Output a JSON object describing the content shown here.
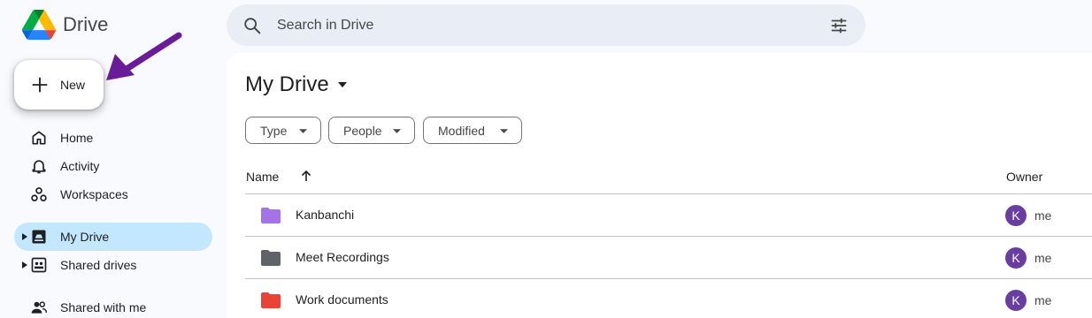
{
  "app": {
    "name": "Drive"
  },
  "search": {
    "placeholder": "Search in Drive"
  },
  "new_button": {
    "label": "New"
  },
  "annotation": {
    "arrow_color": "#6a1b9a"
  },
  "sidebar": {
    "items": [
      {
        "label": "Home",
        "icon": "home-icon"
      },
      {
        "label": "Activity",
        "icon": "bell-icon"
      },
      {
        "label": "Workspaces",
        "icon": "workspaces-icon"
      },
      {
        "label": "My Drive",
        "icon": "my-drive-icon",
        "active": true
      },
      {
        "label": "Shared drives",
        "icon": "shared-drives-icon"
      },
      {
        "label": "Shared with me",
        "icon": "people-icon"
      }
    ]
  },
  "main": {
    "title": "My Drive",
    "filters": [
      {
        "label": "Type"
      },
      {
        "label": "People"
      },
      {
        "label": "Modified"
      }
    ],
    "columns": {
      "name": "Name",
      "owner": "Owner"
    },
    "files": [
      {
        "name": "Kanbanchi",
        "folder_color": "#a374e7",
        "owner_initial": "K",
        "owner": "me"
      },
      {
        "name": "Meet Recordings",
        "folder_color": "#5f6368",
        "owner_initial": "K",
        "owner": "me"
      },
      {
        "name": "Work documents",
        "folder_color": "#ea4335",
        "owner_initial": "K",
        "owner": "me"
      }
    ]
  },
  "colors": {
    "active_nav": "#c2e7ff",
    "search_bg": "#e9eef6",
    "avatar_bg": "#6a3ea1"
  }
}
